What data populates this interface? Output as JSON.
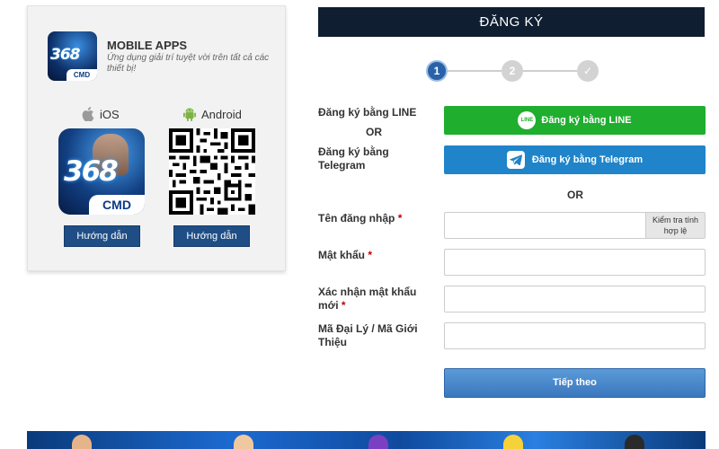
{
  "apps": {
    "title": "MOBILE APPS",
    "subtitle": "Ứng dụng giải trí tuyệt vời trên tất cả các thiết bị!",
    "logo_number": "368",
    "logo_badge": "CMD",
    "ios_label": "iOS",
    "android_label": "Android",
    "guide_ios": "Hướng dẫn",
    "guide_android": "Hướng dẫn",
    "icons": {
      "ios": "apple-icon",
      "android": "android-icon",
      "qr": "qr-code"
    }
  },
  "register": {
    "header": "ĐĂNG KÝ",
    "steps": [
      "1",
      "2",
      "✓"
    ],
    "current_step": 1,
    "line_label": "Đăng ký bằng LINE",
    "or_1": "OR",
    "telegram_label": "Đăng ký bằng Telegram",
    "line_button": "Đăng ký bằng LINE",
    "line_icon_text": "LINE",
    "telegram_button": "Đăng ký bằng Telegram",
    "or_2": "OR",
    "username_label": "Tên đăng nhập",
    "password_label": "Mật khẩu",
    "confirm_label": "Xác nhận mật khẩu mới",
    "referral_label": "Mã Đại Lý / Mã Giới Thiệu",
    "required_mark": "*",
    "check_button": "Kiểm tra tính hợp lệ",
    "next_button": "Tiếp theo",
    "username_value": "",
    "password_value": "",
    "confirm_value": "",
    "referral_value": ""
  },
  "colors": {
    "header_bg": "#0f1e30",
    "line_green": "#1fae2e",
    "telegram_blue": "#1f84c9",
    "step_active": "#2962a8",
    "guide_button": "#1f4e86",
    "required": "#c00000"
  }
}
